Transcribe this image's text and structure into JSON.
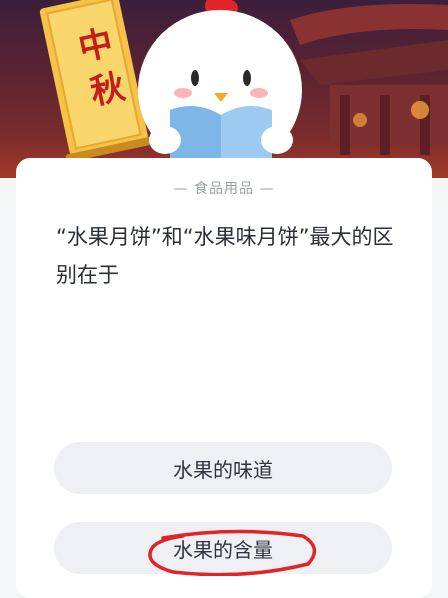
{
  "banner": {
    "scroll_chars": [
      "中",
      "秋"
    ],
    "icons": [
      "festival-scroll-icon",
      "chick-mascot-icon",
      "lantern-pavilion-icon"
    ]
  },
  "quiz": {
    "category": "— 食品用品 —",
    "question": "“水果月饼”和“水果味月饼”最大的区别在于",
    "options": [
      {
        "label": "水果的味道"
      },
      {
        "label": "水果的含量",
        "annotated": true
      }
    ]
  },
  "colors": {
    "accent_red": "#e0252a",
    "banner_dark": "#3b1f3c",
    "scroll_gold": "#f5c24a",
    "option_bg": "#eef0f4"
  }
}
